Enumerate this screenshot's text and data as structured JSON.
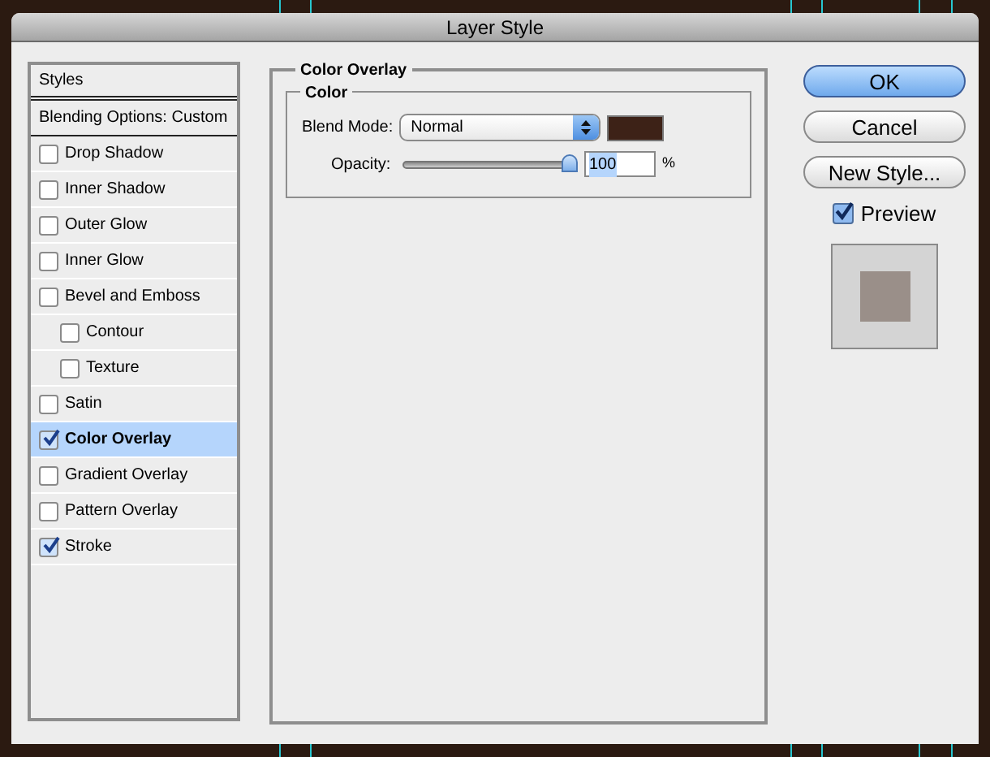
{
  "window": {
    "title": "Layer Style"
  },
  "styles": {
    "header": "Styles",
    "items": [
      {
        "label": "Blending Options: Custom",
        "kind": "heading",
        "selected": false
      },
      {
        "label": "Drop Shadow",
        "kind": "effect",
        "checked": false,
        "selected": false
      },
      {
        "label": "Inner Shadow",
        "kind": "effect",
        "checked": false,
        "selected": false
      },
      {
        "label": "Outer Glow",
        "kind": "effect",
        "checked": false,
        "selected": false
      },
      {
        "label": "Inner Glow",
        "kind": "effect",
        "checked": false,
        "selected": false
      },
      {
        "label": "Bevel and Emboss",
        "kind": "effect",
        "checked": false,
        "selected": false,
        "children": [
          {
            "label": "Contour",
            "kind": "effect",
            "checked": false,
            "selected": false
          },
          {
            "label": "Texture",
            "kind": "effect",
            "checked": false,
            "selected": false
          }
        ]
      },
      {
        "label": "Satin",
        "kind": "effect",
        "checked": false,
        "selected": false
      },
      {
        "label": "Color Overlay",
        "kind": "effect",
        "checked": true,
        "selected": true
      },
      {
        "label": "Gradient Overlay",
        "kind": "effect",
        "checked": false,
        "selected": false
      },
      {
        "label": "Pattern Overlay",
        "kind": "effect",
        "checked": false,
        "selected": false
      },
      {
        "label": "Stroke",
        "kind": "effect",
        "checked": true,
        "selected": false
      }
    ]
  },
  "color_overlay": {
    "title": "Color Overlay",
    "group": "Color",
    "blend_mode_label": "Blend Mode:",
    "blend_mode": "Normal",
    "color": "#3d2217",
    "opacity_label": "Opacity:",
    "opacity": {
      "level": 1,
      "value": "100",
      "unit": "%"
    }
  },
  "buttons": [
    {
      "label": "OK",
      "default": true
    },
    {
      "label": "Cancel",
      "default": false
    },
    {
      "label": "New Style...",
      "default": false
    }
  ],
  "preview": {
    "label": "Preview",
    "checked": true
  }
}
